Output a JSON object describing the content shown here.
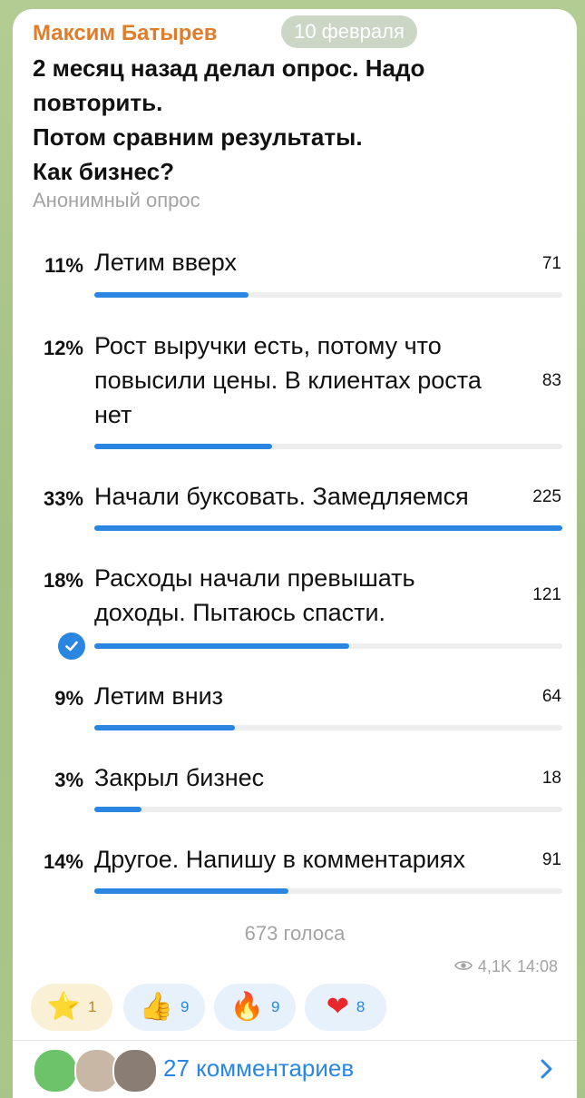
{
  "message": {
    "author": "Максим Батырев",
    "date": "10 февраля",
    "question_lines": [
      "2 месяц назад делал опрос. Надо",
      "повторить.",
      "Потом сравним результаты.",
      "Как бизнес?"
    ],
    "poll_type": "Анонимный опрос"
  },
  "poll": {
    "options": [
      {
        "percent": "11%",
        "lines": [
          "Летим вверх"
        ],
        "votes": "71",
        "fraction": 0.33,
        "selected": false
      },
      {
        "percent": "12%",
        "lines": [
          "Рост выручки есть, потому что",
          "повысили цены. В клиентах роста",
          "нет"
        ],
        "votes": "83",
        "fraction": 0.38,
        "selected": false
      },
      {
        "percent": "33%",
        "lines": [
          "Начали буксовать. Замедляемся"
        ],
        "votes": "225",
        "fraction": 1.0,
        "selected": false
      },
      {
        "percent": "18%",
        "lines": [
          "Расходы начали превышать",
          "доходы. Пытаюсь спасти."
        ],
        "votes": "121",
        "fraction": 0.545,
        "selected": true
      },
      {
        "percent": "9%",
        "lines": [
          "Летим вниз"
        ],
        "votes": "64",
        "fraction": 0.3,
        "selected": false
      },
      {
        "percent": "3%",
        "lines": [
          "Закрыл бизнес"
        ],
        "votes": "18",
        "fraction": 0.1,
        "selected": false
      },
      {
        "percent": "14%",
        "lines": [
          "Другое. Напишу в комментариях"
        ],
        "votes": "91",
        "fraction": 0.415,
        "selected": false
      }
    ],
    "total": "673 голоса"
  },
  "meta": {
    "views": "4,1K",
    "time": "14:08"
  },
  "reactions": [
    {
      "name": "star",
      "emoji": "⭐",
      "count": "1"
    },
    {
      "name": "thumbs-up",
      "emoji": "👍",
      "count": "9"
    },
    {
      "name": "fire",
      "emoji": "🔥",
      "count": "9"
    },
    {
      "name": "heart",
      "emoji": "❤",
      "count": "8"
    }
  ],
  "comments": {
    "label": "27 комментариев"
  },
  "colors": {
    "accent": "#2a86e0",
    "author": "#e07d2a",
    "track": "#eeeeee"
  }
}
